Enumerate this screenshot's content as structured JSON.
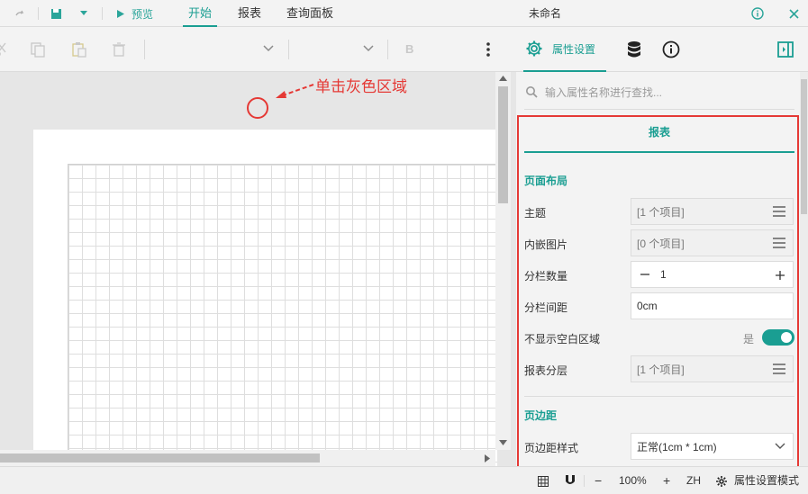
{
  "titlebar": {
    "preview_label": "预览",
    "menus": [
      "开始",
      "报表",
      "查询面板"
    ],
    "active_menu": "开始",
    "doc_title": "未命名"
  },
  "toolbar": {
    "font_size_placeholder": "",
    "bold_label": "B"
  },
  "annotation": {
    "text": "单击灰色区域"
  },
  "right_panel": {
    "tab_label": "属性设置",
    "search_placeholder": "输入属性名称进行查找...",
    "section_tab": "报表",
    "groups": [
      {
        "title": "页面布局",
        "props": [
          {
            "label": "主题",
            "value": "[1 个项目]"
          },
          {
            "label": "内嵌图片",
            "value": "[0 个项目]"
          },
          {
            "label": "分栏数量",
            "value": "1"
          },
          {
            "label": "分栏间距",
            "value": "0cm"
          },
          {
            "label": "不显示空白区域",
            "value": "是"
          },
          {
            "label": "报表分层",
            "value": "[1 个项目]"
          }
        ]
      },
      {
        "title": "页边距",
        "props": [
          {
            "label": "页边距样式",
            "value": "正常(1cm * 1cm)"
          }
        ]
      }
    ]
  },
  "statusbar": {
    "zoom_minus": "−",
    "zoom": "100%",
    "zoom_plus": "+",
    "lang": "ZH",
    "mode": "属性设置模式"
  },
  "colors": {
    "accent": "#1a9e92",
    "highlight": "#e53935"
  }
}
